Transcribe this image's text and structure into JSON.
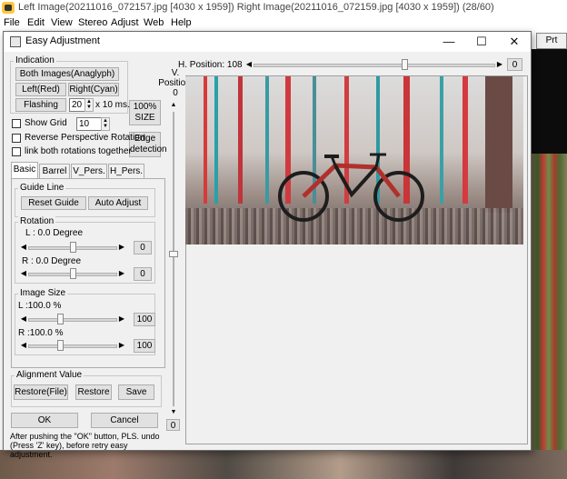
{
  "main_window": {
    "title": "Left Image(20211016_072157.jpg [4030 x 1959]) Right Image(20211016_072159.jpg [4030 x 1959])  (28/60)",
    "menu": [
      "File",
      "Edit",
      "View",
      "Stereo",
      "Adjust",
      "Web",
      "Help"
    ],
    "prt_button": "Prt"
  },
  "dialog": {
    "title": "Easy Adjustment",
    "window_controls": [
      "—",
      "☐",
      "✕"
    ],
    "indication": {
      "group_label": "Indication",
      "both_images": "Both Images(Anaglyph)",
      "left": "Left(Red)",
      "right": "Right(Cyan)",
      "flashing": "Flashing",
      "flash_value": "20",
      "flash_unit": "x 10 ms."
    },
    "size_button": "100%\nSIZE",
    "size_line1": "100%",
    "size_line2": "SIZE",
    "edge_line1": "Edge",
    "edge_line2": "detection",
    "show_grid": "Show Grid",
    "grid_value": "10",
    "reverse_perspective": "Reverse Perspective Rotation",
    "link_rotations": "link both rotations together",
    "tabs": [
      "Basic",
      "Barrel",
      "V_Pers.",
      "H_Pers."
    ],
    "active_tab": "Basic",
    "guide_line": {
      "group_label": "Guide Line",
      "reset": "Reset Guide",
      "auto": "Auto Adjust"
    },
    "rotation": {
      "group_label": "Rotation",
      "left_label": "L : 0.0 Degree",
      "left_value": "0",
      "left_level": 0.5,
      "right_label": "R : 0.0 Degree",
      "right_value": "0",
      "right_level": 0.5
    },
    "image_size": {
      "group_label": "Image Size",
      "left_label": "L :100.0 %",
      "left_value": "100",
      "left_level": 0.35,
      "right_label": "R :100.0 %",
      "right_value": "100",
      "right_level": 0.35
    },
    "alignment": {
      "group_label": "Alignment Value",
      "restore_file": "Restore(File)",
      "restore": "Restore",
      "save": "Save"
    },
    "ok": "OK",
    "cancel": "Cancel",
    "note": "After pushing the \"OK\" button, PLS. undo (Press 'Z' key), before retry easy adjustment.",
    "h_position_label": "H. Position:",
    "h_position_value": "108",
    "h_position_box": "0",
    "h_position_level": 0.63,
    "v_position_label_1": "V.",
    "v_position_label_2": "Position",
    "v_position_value": "0",
    "v_position_box": "0"
  },
  "colors": {
    "dialog_bg": "#f0f0f0",
    "button_bg": "#e1e1e1",
    "button_border": "#adadad"
  }
}
